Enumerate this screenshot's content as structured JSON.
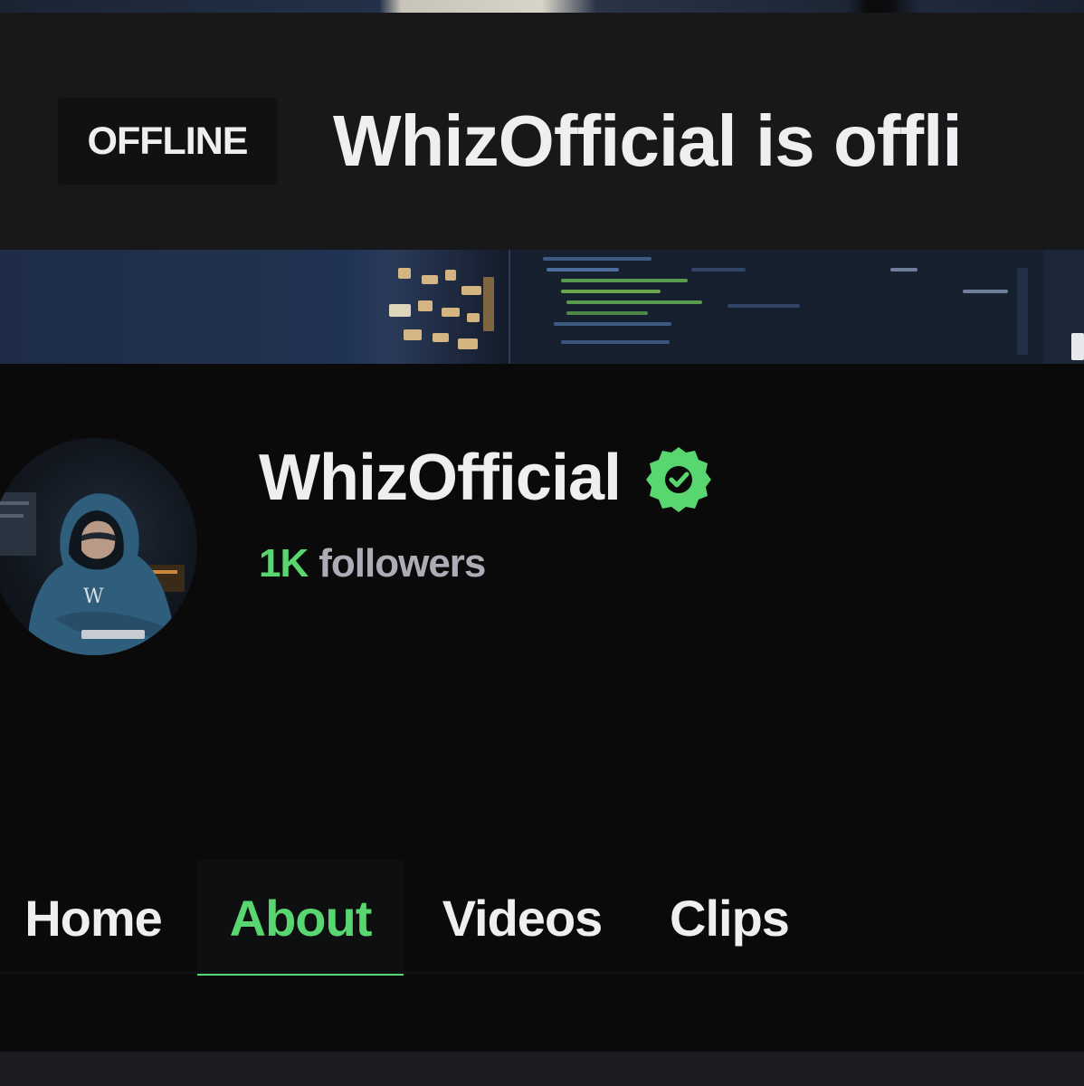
{
  "offline_header": {
    "badge": "OFFLINE",
    "title": "WhizOfficial is offli"
  },
  "channel": {
    "name": "WhizOfficial",
    "verified_icon": "verified-check-icon",
    "followers_count": "1K",
    "followers_label": "followers",
    "avatar_monogram": "W"
  },
  "tabs": [
    {
      "label": "Home",
      "active": false
    },
    {
      "label": "About",
      "active": true
    },
    {
      "label": "Videos",
      "active": false
    },
    {
      "label": "Clips",
      "active": false
    }
  ],
  "colors": {
    "accent": "#58d66f",
    "background": "#0a0a0b",
    "header_background": "#18181b",
    "text_primary": "#efeff1",
    "text_secondary": "#adadb8"
  }
}
